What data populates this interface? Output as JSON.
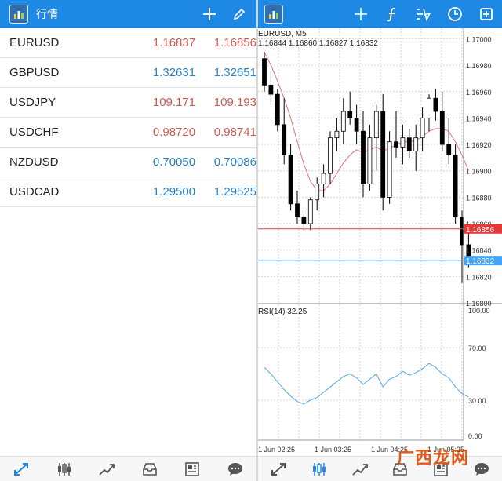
{
  "left_header": {
    "title": "行情"
  },
  "quotes": [
    {
      "symbol": "EURUSD",
      "bid": "1.16837",
      "ask": "1.16856",
      "dir": "down"
    },
    {
      "symbol": "GBPUSD",
      "bid": "1.32631",
      "ask": "1.32651",
      "dir": "up"
    },
    {
      "symbol": "USDJPY",
      "bid": "109.171",
      "ask": "109.193",
      "dir": "down"
    },
    {
      "symbol": "USDCHF",
      "bid": "0.98720",
      "ask": "0.98741",
      "dir": "down"
    },
    {
      "symbol": "NZDUSD",
      "bid": "0.70050",
      "ask": "0.70086",
      "dir": "up"
    },
    {
      "symbol": "USDCAD",
      "bid": "1.29500",
      "ask": "1.29525",
      "dir": "up"
    }
  ],
  "chart": {
    "title": "EURUSD, M5",
    "ohlc_text": "1.16844 1.16860 1.16827 1.16832",
    "rsi_title": "RSI(14) 32.25",
    "price_ticks": [
      "1.16820",
      "1.16840",
      "1.16860",
      "1.16880",
      "1.16900",
      "1.16920",
      "1.16940",
      "1.16960",
      "1.16980",
      "1.17000"
    ],
    "extra_tick": "1.16800",
    "ask_tag": "1.16856",
    "bid_tag": "1.16832",
    "rsi_ticks": [
      "100.00",
      "70.00",
      "30.00",
      "0.00"
    ],
    "time_labels": [
      "1 Jun 02:25",
      "1 Jun 03:25",
      "1 Jun 04:25",
      "1 Jun 05:25"
    ],
    "colors": {
      "ask_line": "#e53935",
      "bid_line": "#42a5f5",
      "ma": "#e57373",
      "rsi": "#5aa5e0",
      "header": "#1e88e5"
    }
  },
  "chart_data": {
    "type": "candlestick",
    "title": "EURUSD, M5",
    "ylim": [
      1.168,
      1.17008
    ],
    "candles": [
      {
        "o": 1.16985,
        "h": 1.1699,
        "l": 1.1696,
        "c": 1.16965
      },
      {
        "o": 1.16965,
        "h": 1.16975,
        "l": 1.1695,
        "c": 1.16958
      },
      {
        "o": 1.16958,
        "h": 1.16962,
        "l": 1.1693,
        "c": 1.16935
      },
      {
        "o": 1.16935,
        "h": 1.16955,
        "l": 1.16905,
        "c": 1.16912
      },
      {
        "o": 1.16912,
        "h": 1.1692,
        "l": 1.1687,
        "c": 1.16875
      },
      {
        "o": 1.16875,
        "h": 1.16885,
        "l": 1.1686,
        "c": 1.16865
      },
      {
        "o": 1.16865,
        "h": 1.1687,
        "l": 1.16855,
        "c": 1.1686
      },
      {
        "o": 1.1686,
        "h": 1.1688,
        "l": 1.16855,
        "c": 1.16878
      },
      {
        "o": 1.16878,
        "h": 1.16895,
        "l": 1.1687,
        "c": 1.1689
      },
      {
        "o": 1.1689,
        "h": 1.16905,
        "l": 1.1688,
        "c": 1.16898
      },
      {
        "o": 1.16898,
        "h": 1.1693,
        "l": 1.1689,
        "c": 1.16925
      },
      {
        "o": 1.16925,
        "h": 1.1694,
        "l": 1.16915,
        "c": 1.1693
      },
      {
        "o": 1.1693,
        "h": 1.16955,
        "l": 1.1692,
        "c": 1.16945
      },
      {
        "o": 1.16945,
        "h": 1.1696,
        "l": 1.16935,
        "c": 1.1694
      },
      {
        "o": 1.1694,
        "h": 1.1695,
        "l": 1.1692,
        "c": 1.1693
      },
      {
        "o": 1.1693,
        "h": 1.16945,
        "l": 1.1688,
        "c": 1.1689
      },
      {
        "o": 1.1689,
        "h": 1.16935,
        "l": 1.16885,
        "c": 1.16925
      },
      {
        "o": 1.16925,
        "h": 1.1695,
        "l": 1.169,
        "c": 1.16945
      },
      {
        "o": 1.16945,
        "h": 1.16958,
        "l": 1.1687,
        "c": 1.1688
      },
      {
        "o": 1.1688,
        "h": 1.1693,
        "l": 1.16875,
        "c": 1.16922
      },
      {
        "o": 1.16922,
        "h": 1.16945,
        "l": 1.1691,
        "c": 1.16918
      },
      {
        "o": 1.16918,
        "h": 1.16935,
        "l": 1.16905,
        "c": 1.16925
      },
      {
        "o": 1.16925,
        "h": 1.16932,
        "l": 1.1691,
        "c": 1.16915
      },
      {
        "o": 1.16915,
        "h": 1.16935,
        "l": 1.169,
        "c": 1.16925
      },
      {
        "o": 1.16925,
        "h": 1.16948,
        "l": 1.16915,
        "c": 1.1694
      },
      {
        "o": 1.1694,
        "h": 1.16958,
        "l": 1.1693,
        "c": 1.16955
      },
      {
        "o": 1.16955,
        "h": 1.16962,
        "l": 1.16938,
        "c": 1.16945
      },
      {
        "o": 1.16945,
        "h": 1.1696,
        "l": 1.16915,
        "c": 1.1692
      },
      {
        "o": 1.1692,
        "h": 1.1694,
        "l": 1.16905,
        "c": 1.16912
      },
      {
        "o": 1.16912,
        "h": 1.1692,
        "l": 1.1686,
        "c": 1.16865
      },
      {
        "o": 1.16865,
        "h": 1.1687,
        "l": 1.16815,
        "c": 1.16844
      },
      {
        "o": 1.16844,
        "h": 1.1686,
        "l": 1.16827,
        "c": 1.16832
      }
    ],
    "ma": [
      1.1699,
      1.1698,
      1.16968,
      1.16955,
      1.1694,
      1.16922,
      1.16905,
      1.16892,
      1.16885,
      1.16885,
      1.1689,
      1.16898,
      1.16906,
      1.16912,
      1.16916,
      1.16914,
      1.16916,
      1.16918,
      1.16915,
      1.16917,
      1.1692,
      1.16922,
      1.16922,
      1.16923,
      1.16926,
      1.1693,
      1.16932,
      1.16932,
      1.1693,
      1.16922,
      1.16912,
      1.169
    ],
    "rsi": [
      55,
      50,
      44,
      38,
      33,
      29,
      27,
      30,
      32,
      36,
      40,
      44,
      48,
      50,
      47,
      42,
      46,
      50,
      40,
      46,
      48,
      52,
      49,
      51,
      54,
      58,
      55,
      50,
      47,
      40,
      35,
      32.25
    ],
    "rsi_ylim": [
      0,
      100
    ]
  }
}
